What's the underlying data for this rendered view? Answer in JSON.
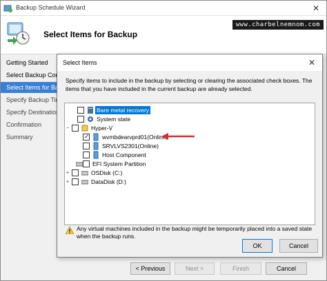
{
  "wizard": {
    "title": "Backup Schedule Wizard",
    "header_title": "Select Items for Backup",
    "watermark": "www.charbelnemnom.com",
    "steps": [
      {
        "label": "Getting Started",
        "state": "done"
      },
      {
        "label": "Select Backup Conf",
        "state": "done"
      },
      {
        "label": "Select Items for Back",
        "state": "active"
      },
      {
        "label": "Specify Backup Tim",
        "state": "pending"
      },
      {
        "label": "Specify Destination",
        "state": "pending"
      },
      {
        "label": "Confirmation",
        "state": "pending"
      },
      {
        "label": "Summary",
        "state": "pending"
      }
    ],
    "buttons": {
      "previous": "< Previous",
      "next": "Next >",
      "finish": "Finish",
      "cancel": "Cancel"
    }
  },
  "dialog": {
    "title": "Select Items",
    "description": "Specify items to include in the backup by selecting or clearing the associated check boxes. The items that you have included in the current backup are already selected.",
    "tree": [
      {
        "label": "Bare metal recovery",
        "checked": false,
        "selected": true,
        "icon": "bare-metal-icon"
      },
      {
        "label": "System state",
        "checked": false,
        "selected": false,
        "icon": "system-state-icon"
      },
      {
        "label": "Hyper-V",
        "checked": false,
        "selected": false,
        "icon": "hyperv-icon"
      },
      {
        "label": "wvmbdearvprd01(Online)",
        "checked": true,
        "selected": false,
        "icon": "vm-icon"
      },
      {
        "label": "SRVLVS2301(Online)",
        "checked": false,
        "selected": false,
        "icon": "vm-icon"
      },
      {
        "label": "Host Component",
        "checked": false,
        "selected": false,
        "icon": "vm-icon"
      },
      {
        "label": "EFI System Partition",
        "checked": false,
        "selected": false,
        "icon": "drive-icon"
      },
      {
        "label": "OSDisk (C:)",
        "checked": false,
        "selected": false,
        "icon": "drive-icon"
      },
      {
        "label": "DataDisk (D:)",
        "checked": false,
        "selected": false,
        "icon": "drive-icon"
      }
    ],
    "warning": "Any virtual machines included in the backup might be temporarily placed into a saved state when the backup runs.",
    "ok_label": "OK",
    "cancel_label": "Cancel",
    "arrow_color": "#d9282f"
  }
}
